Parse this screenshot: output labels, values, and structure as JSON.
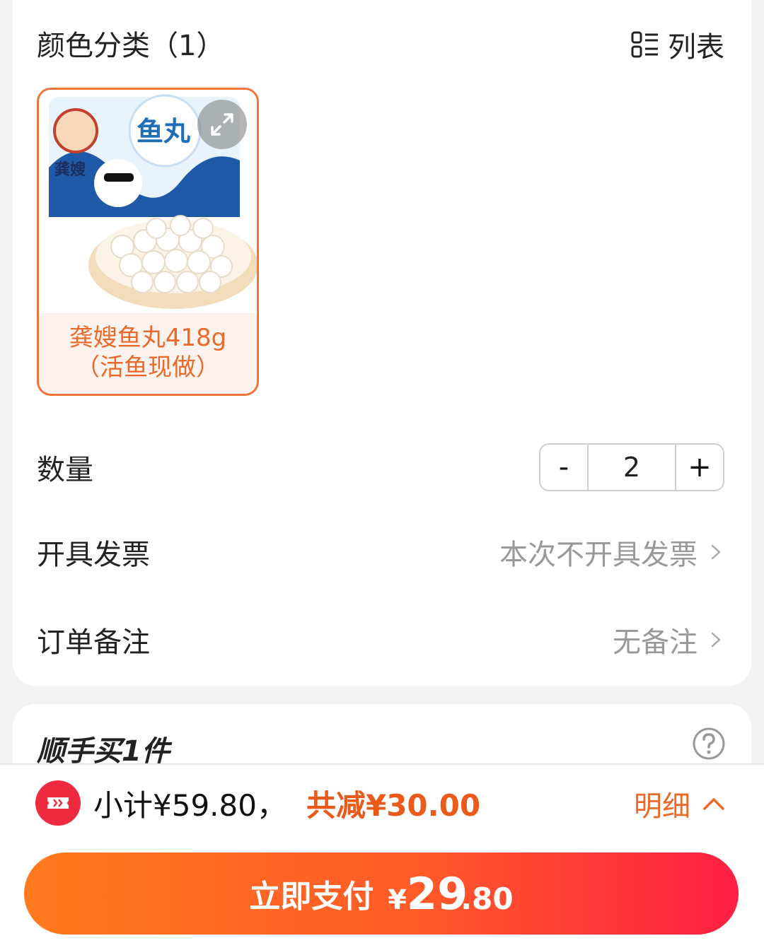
{
  "section": {
    "title": "颜色分类（1）",
    "view_toggle_label": "列表"
  },
  "variant": {
    "name": "龚嫂鱼丸418g（活鱼现做）",
    "selected": true,
    "image_brand_text": "龚嫂",
    "image_product_text": "鱼丸"
  },
  "quantity": {
    "label": "数量",
    "minus": "-",
    "value": "2",
    "plus": "+"
  },
  "invoice": {
    "label": "开具发票",
    "value": "本次不开具发票"
  },
  "remark": {
    "label": "订单备注",
    "value": "无备注"
  },
  "addon": {
    "title": "顺手买1件"
  },
  "footer": {
    "subtotal": "小计¥59.80，",
    "discount": "共减¥30.00",
    "details_label": "明细",
    "pay_label": "立即支付",
    "pay_currency": "¥",
    "pay_int": "29",
    "pay_dec": ".80"
  },
  "colors": {
    "accent": "#ea6a2c",
    "pay_gradient_start": "#ff7a1c",
    "pay_gradient_end": "#ff1f44",
    "coupon_red": "#ee2a3f"
  }
}
